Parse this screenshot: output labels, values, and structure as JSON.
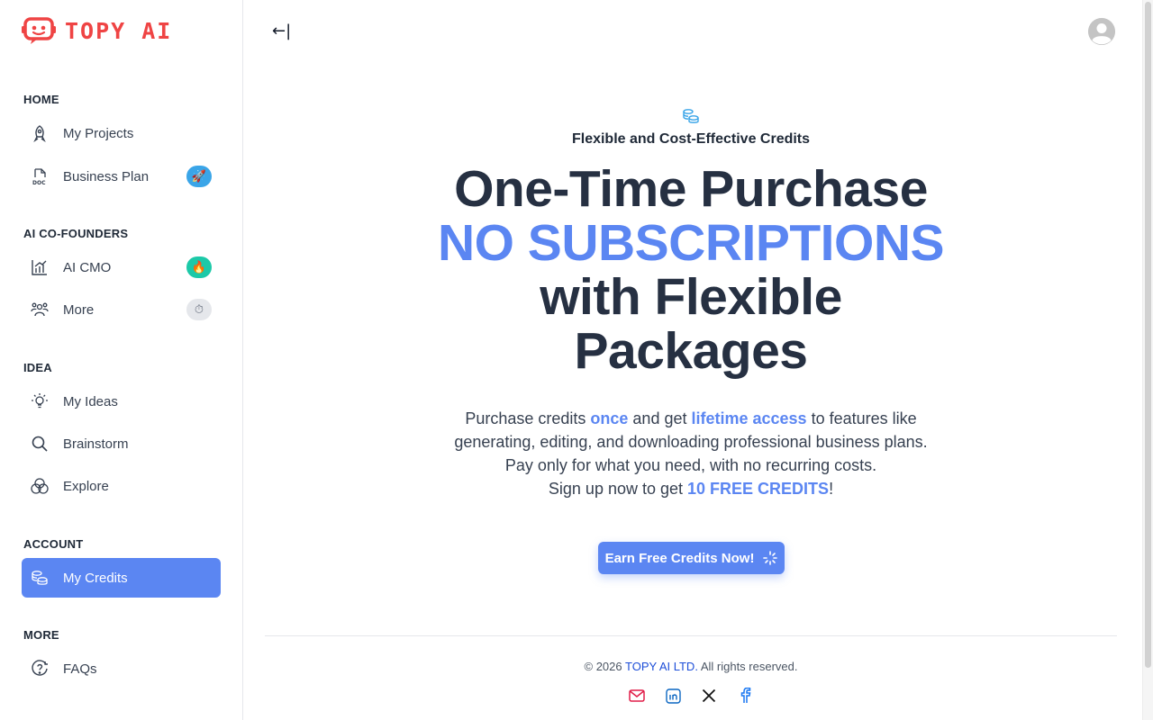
{
  "brand": {
    "name": "TOPY AI",
    "color": "#ef4444"
  },
  "sidebar": {
    "sections": [
      {
        "title": "HOME"
      },
      {
        "title": "AI CO-FOUNDERS"
      },
      {
        "title": "IDEA"
      },
      {
        "title": "ACCOUNT"
      },
      {
        "title": "MORE"
      }
    ],
    "items": {
      "my_projects": {
        "label": "My Projects",
        "icon": "rocket-icon"
      },
      "business_plan": {
        "label": "Business Plan",
        "icon": "doc-icon",
        "badge": "🚀"
      },
      "ai_cmo": {
        "label": "AI CMO",
        "icon": "growth-chart-icon",
        "badge": "🔥"
      },
      "more": {
        "label": "More",
        "icon": "team-icon",
        "badge": "⏱"
      },
      "my_ideas": {
        "label": "My Ideas",
        "icon": "lightbulb-icon"
      },
      "brainstorm": {
        "label": "Brainstorm",
        "icon": "search-icon"
      },
      "explore": {
        "label": "Explore",
        "icon": "explore-icon"
      },
      "my_credits": {
        "label": "My Credits",
        "icon": "coins-icon",
        "active": true
      },
      "faqs": {
        "label": "FAQs",
        "icon": "help-icon"
      }
    }
  },
  "header": {
    "collapse_glyph": "←|"
  },
  "hero": {
    "eyebrow": "Flexible and Cost-Effective Credits",
    "headline_1": "One-Time Purchase",
    "headline_accent": "NO SUBSCRIPTIONS",
    "headline_2": "with Flexible",
    "headline_3": "Packages",
    "desc_1": "Purchase credits ",
    "desc_hl_1": "once",
    "desc_2": " and get ",
    "desc_hl_2": "lifetime access",
    "desc_3": " to features like generating, editing, and downloading professional business plans. Pay only for what you need, with no recurring costs.",
    "desc_4": "Sign up now to get ",
    "desc_hl_3": "10 FREE CREDITS",
    "desc_5": "!",
    "cta_label": "Earn Free Credits Now!"
  },
  "footer": {
    "copyright_prefix": "© 2026 ",
    "copyright_brand": "TOPY AI LTD.",
    "copyright_suffix": " All rights reserved.",
    "social": [
      "mail-icon",
      "linkedin-icon",
      "x-icon",
      "facebook-icon"
    ]
  },
  "colors": {
    "accent": "#5b86f2",
    "text": "#263042"
  }
}
